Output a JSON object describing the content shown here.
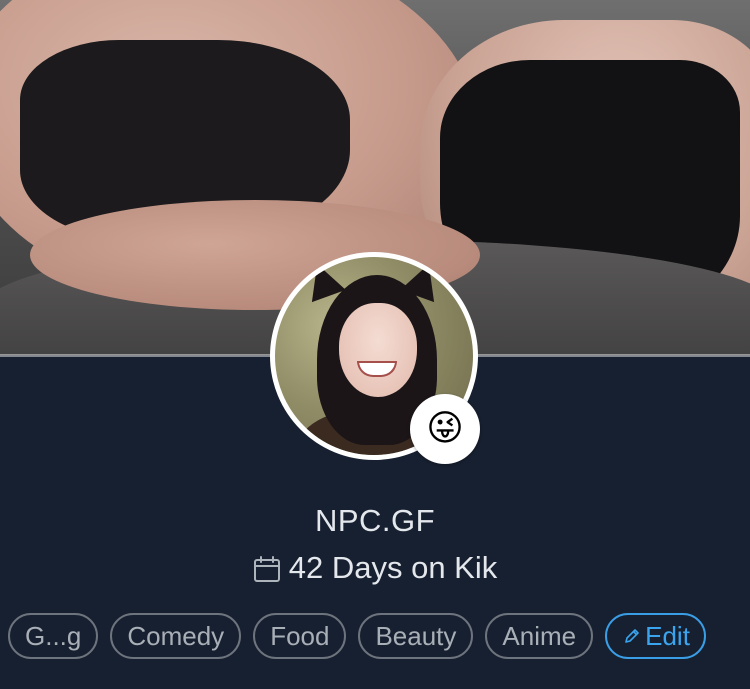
{
  "profile": {
    "display_name": "NPC.GF",
    "days_on_kik": "42 Days on Kik",
    "mood_emoji": "😜"
  },
  "icons": {
    "calendar": "calendar-icon",
    "edit": "pencil-icon"
  },
  "interests": [
    {
      "label": "G...g"
    },
    {
      "label": "Comedy"
    },
    {
      "label": "Food"
    },
    {
      "label": "Beauty"
    },
    {
      "label": "Anime"
    }
  ],
  "edit_label": "Edit",
  "colors": {
    "background": "#172030",
    "chip_border": "#6e747d",
    "accent": "#3aa4ee"
  }
}
